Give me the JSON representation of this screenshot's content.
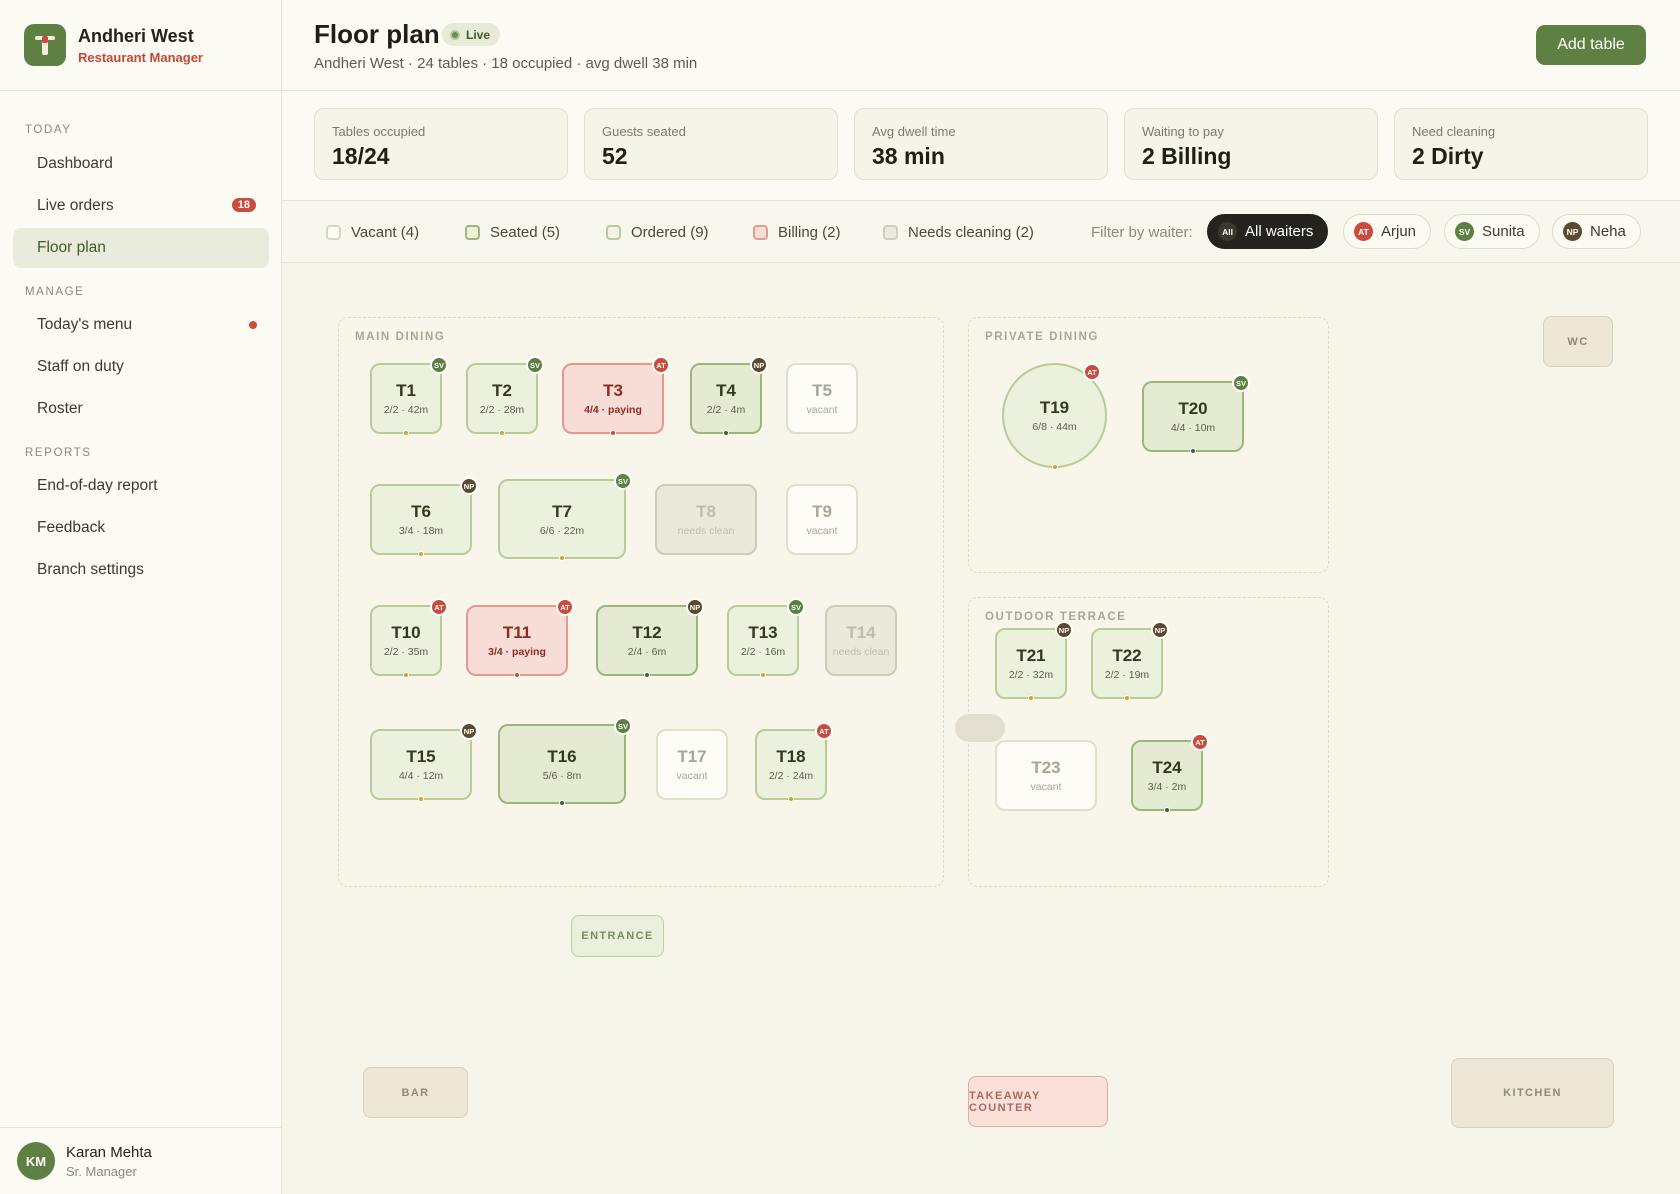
{
  "brand": {
    "name": "Andheri West",
    "subtitle": "Restaurant Manager"
  },
  "sidebar": {
    "sections": [
      "TODAY",
      "MANAGE",
      "REPORTS"
    ],
    "items": [
      {
        "label": "Dashboard"
      },
      {
        "label": "Live orders",
        "badge": "18"
      },
      {
        "label": "Floor plan",
        "active": true
      },
      {
        "label": "Today's menu",
        "dot": true
      },
      {
        "label": "Staff on duty"
      },
      {
        "label": "Roster"
      },
      {
        "label": "End-of-day report"
      },
      {
        "label": "Feedback"
      },
      {
        "label": "Branch settings"
      }
    ]
  },
  "user": {
    "initials": "KM",
    "name": "Karan Mehta",
    "role": "Sr. Manager"
  },
  "header": {
    "title": "Floor plan",
    "live_label": "Live",
    "subtitle": "Andheri West · 24 tables · 18 occupied · avg dwell 38 min",
    "add_button": "Add table"
  },
  "stats": [
    {
      "label": "Tables occupied",
      "value": "18/24"
    },
    {
      "label": "Guests seated",
      "value": "52"
    },
    {
      "label": "Avg dwell time",
      "value": "38 min"
    },
    {
      "label": "Waiting to pay",
      "value": "2 Billing"
    },
    {
      "label": "Need cleaning",
      "value": "2 Dirty"
    }
  ],
  "legend": [
    {
      "label": "Vacant (4)",
      "border": "#d9d6c4",
      "fill": "#fdfcf6"
    },
    {
      "label": "Seated (5)",
      "border": "#9db77b",
      "fill": "#ecf1dd"
    },
    {
      "label": "Ordered (9)",
      "border": "#b8cd95",
      "fill": "#f1f4e6"
    },
    {
      "label": "Billing (2)",
      "border": "#e59a8d",
      "fill": "#f8dcd6"
    },
    {
      "label": "Needs cleaning (2)",
      "border": "#d2cebd",
      "fill": "#ebe8dc"
    }
  ],
  "filter": {
    "label": "Filter by waiter:",
    "waiters": [
      {
        "initials": "All",
        "name": "All waiters",
        "color": "#24231d",
        "active": true
      },
      {
        "initials": "AT",
        "name": "Arjun",
        "color": "#c94c3c"
      },
      {
        "initials": "SV",
        "name": "Sunita",
        "color": "#5e8042"
      },
      {
        "initials": "NP",
        "name": "Neha",
        "color": "#5b4a2e"
      }
    ]
  },
  "colors": {
    "AT": "#c94c3c",
    "SV": "#5e8042",
    "NP": "#5b4a2e",
    "accent": "#5e8042"
  },
  "zones": [
    {
      "label": "MAIN DINING"
    },
    {
      "label": "PRIVATE DINING"
    },
    {
      "label": "OUTDOOR TERRACE"
    }
  ],
  "tables": [
    {
      "name": "T1",
      "meta": "2/2 · 42m",
      "status": "seated",
      "waiter": "SV",
      "dot": "#d4a32a"
    },
    {
      "name": "T2",
      "meta": "2/2 · 28m",
      "status": "seated",
      "waiter": "SV",
      "dot": "#d4a32a"
    },
    {
      "name": "T3",
      "meta": "4/4 · paying",
      "status": "billing",
      "waiter": "AT",
      "dot": "#c94c3c"
    },
    {
      "name": "T4",
      "meta": "2/2 · 4m",
      "status": "ordered",
      "waiter": "NP",
      "dot": "#4a5a38"
    },
    {
      "name": "T5",
      "meta": "vacant",
      "status": "vacant"
    },
    {
      "name": "T6",
      "meta": "3/4 · 18m",
      "status": "seated",
      "waiter": "NP",
      "dot": "#d4a32a"
    },
    {
      "name": "T7",
      "meta": "6/6 · 22m",
      "status": "seated",
      "waiter": "SV",
      "dot": "#d4a32a"
    },
    {
      "name": "T8",
      "meta": "needs clean",
      "status": "dirty"
    },
    {
      "name": "T9",
      "meta": "vacant",
      "status": "vacant"
    },
    {
      "name": "T10",
      "meta": "2/2 · 35m",
      "status": "seated",
      "waiter": "AT",
      "dot": "#d4a32a"
    },
    {
      "name": "T11",
      "meta": "3/4 · paying",
      "status": "billing",
      "waiter": "AT",
      "dot": "#c94c3c"
    },
    {
      "name": "T12",
      "meta": "2/4 · 6m",
      "status": "ordered",
      "waiter": "NP",
      "dot": "#4a5a38"
    },
    {
      "name": "T13",
      "meta": "2/2 · 16m",
      "status": "seated",
      "waiter": "SV",
      "dot": "#d4a32a"
    },
    {
      "name": "T14",
      "meta": "needs clean",
      "status": "dirty"
    },
    {
      "name": "T15",
      "meta": "4/4 · 12m",
      "status": "seated",
      "waiter": "NP",
      "dot": "#d4a32a"
    },
    {
      "name": "T16",
      "meta": "5/6 · 8m",
      "status": "ordered",
      "waiter": "SV",
      "dot": "#4a5a38"
    },
    {
      "name": "T17",
      "meta": "vacant",
      "status": "vacant"
    },
    {
      "name": "T18",
      "meta": "2/2 · 24m",
      "status": "seated",
      "waiter": "AT",
      "dot": "#d4a32a"
    },
    {
      "name": "T19",
      "meta": "6/8 · 44m",
      "status": "seated",
      "waiter": "AT",
      "dot": "#d4a32a",
      "round": true
    },
    {
      "name": "T20",
      "meta": "4/4 · 10m",
      "status": "ordered",
      "waiter": "SV",
      "dot": "#4a5a38"
    },
    {
      "name": "T21",
      "meta": "2/2 · 32m",
      "status": "seated",
      "waiter": "NP",
      "dot": "#d4a32a"
    },
    {
      "name": "T22",
      "meta": "2/2 · 19m",
      "status": "seated",
      "waiter": "NP",
      "dot": "#d4a32a"
    },
    {
      "name": "T23",
      "meta": "vacant",
      "status": "vacant"
    },
    {
      "name": "T24",
      "meta": "3/4 · 2m",
      "status": "ordered",
      "waiter": "AT",
      "dot": "#4a5a38"
    }
  ],
  "fixtures": [
    {
      "label": "WC",
      "kind": "plain"
    },
    {
      "label": "ENTRANCE",
      "kind": "entrance"
    },
    {
      "label": "BAR",
      "kind": "plain"
    },
    {
      "label": "TAKEAWAY COUNTER",
      "kind": "takeaway"
    },
    {
      "label": "KITCHEN",
      "kind": "plain"
    }
  ]
}
